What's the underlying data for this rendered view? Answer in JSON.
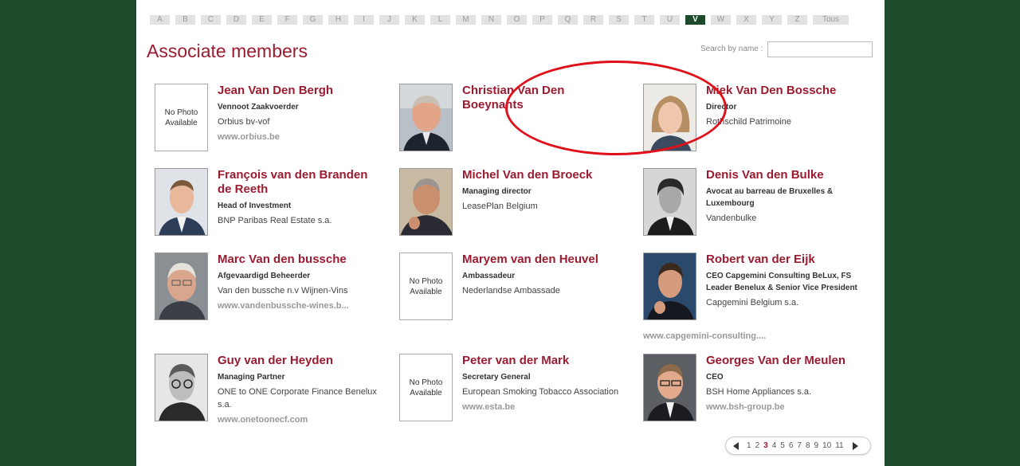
{
  "alphabet": [
    "A",
    "B",
    "C",
    "D",
    "E",
    "F",
    "G",
    "H",
    "I",
    "J",
    "K",
    "L",
    "M",
    "N",
    "O",
    "P",
    "Q",
    "R",
    "S",
    "T",
    "U",
    "V",
    "W",
    "X",
    "Y",
    "Z",
    "Tous"
  ],
  "active_letter": "V",
  "title": "Associate members",
  "search": {
    "label": "Search by name :",
    "value": ""
  },
  "no_photo_text": "No Photo Available",
  "members": [
    {
      "name": "Jean Van Den Bergh",
      "role": "Vennoot Zaakvoerder",
      "org": "Orbius bv-vof",
      "web": "www.orbius.be",
      "photo": "none"
    },
    {
      "name": "Christian Van Den Boeynants",
      "role": "",
      "org": "",
      "web": "",
      "photo": "portrait"
    },
    {
      "name": "Miek Van Den Bossche",
      "role": "Director",
      "org": "Rothschild Patrimoine",
      "web": "",
      "photo": "portrait"
    },
    {
      "name": "François van den Branden de Reeth",
      "role": "Head of Investment",
      "org": "BNP Paribas Real Estate s.a.",
      "web": "",
      "photo": "portrait"
    },
    {
      "name": "Michel Van den Broeck",
      "role": "Managing director",
      "org": "LeasePlan Belgium",
      "web": "",
      "photo": "portrait"
    },
    {
      "name": "Denis Van den Bulke",
      "role": "Avocat au barreau de Bruxelles & Luxembourg",
      "org": "Vandenbulke",
      "web": "",
      "photo": "portrait"
    },
    {
      "name": "Marc Van den bussche",
      "role": "Afgevaardigd Beheerder",
      "org": "Van den bussche n.v Wijnen-Vins",
      "web": "www.vandenbussche-wines.b...",
      "photo": "portrait"
    },
    {
      "name": "Maryem van den Heuvel",
      "role": "Ambassadeur",
      "org": "Nederlandse Ambassade",
      "web": "",
      "photo": "none"
    },
    {
      "name": "Robert van der Eijk",
      "role": "CEO Capgemini Consulting BeLux, FS Leader Benelux & Senior Vice President",
      "org": "Capgemini Belgium s.a.",
      "web": "www.capgemini-consulting....",
      "photo": "portrait"
    },
    {
      "name": "Guy van der Heyden",
      "role": "Managing Partner",
      "org": "ONE to ONE Corporate Finance Benelux s.a.",
      "web": "www.onetoonecf.com",
      "photo": "portrait"
    },
    {
      "name": "Peter van der Mark",
      "role": "Secretary General",
      "org": "European Smoking Tobacco Association",
      "web": "www.esta.be",
      "photo": "none"
    },
    {
      "name": "Georges Van der Meulen",
      "role": "CEO",
      "org": "BSH Home Appliances s.a.",
      "web": "www.bsh-group.be",
      "photo": "portrait"
    }
  ],
  "pagination": {
    "pages": [
      "1",
      "2",
      "3",
      "4",
      "5",
      "6",
      "7",
      "8",
      "9",
      "10",
      "11"
    ],
    "current": "3"
  }
}
